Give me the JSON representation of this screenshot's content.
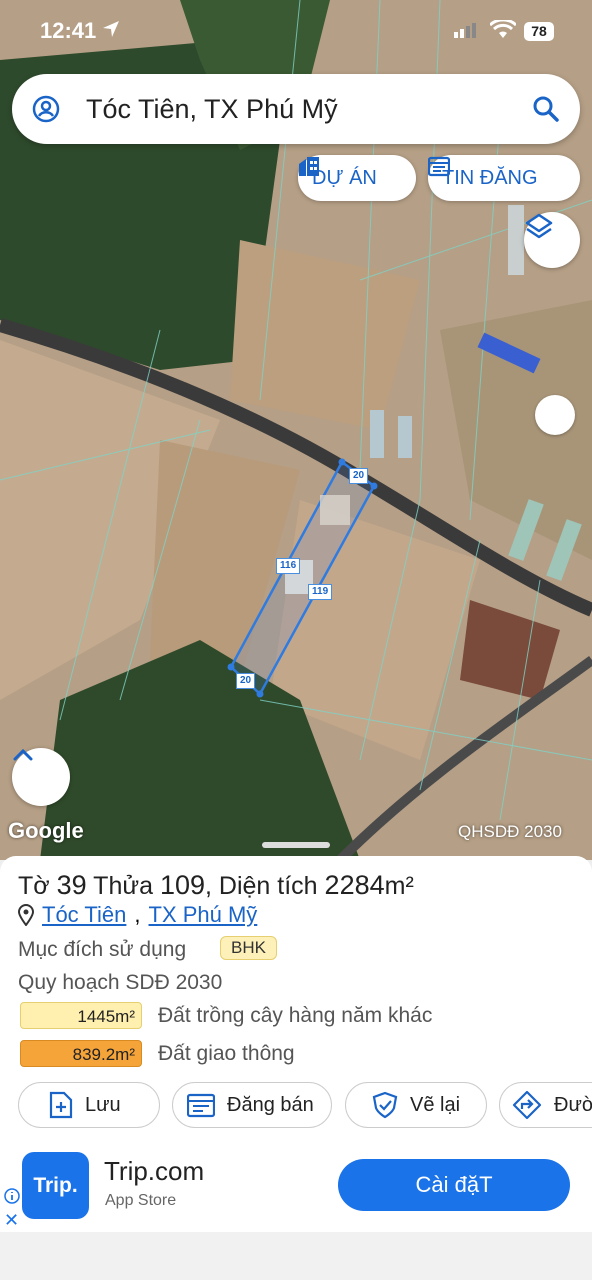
{
  "status_bar": {
    "time": "12:41",
    "battery": "78"
  },
  "search": {
    "text": "Tóc Tiên, TX Phú Mỹ"
  },
  "chips": {
    "projects": "DỰ ÁN",
    "listings": "TIN ĐĂNG"
  },
  "map": {
    "google": "Google",
    "layer": "QHSDĐ 2030",
    "edges": {
      "top": "20",
      "left": "116",
      "right": "119",
      "bottom": "20"
    }
  },
  "parcel": {
    "title_prefix": "Tờ",
    "sheet_no": "39",
    "lot_label": "Thửa",
    "lot_no": "109",
    "area_label": "Diện tích",
    "area_value": "2284",
    "area_unit": "m²",
    "commune": "Tóc Tiên",
    "town": "TX Phú Mỹ",
    "usage_label": "Mục đích sử dụng",
    "usage_code": "BHK",
    "plan_label": "Quy hoạch SDĐ 2030",
    "zones": [
      {
        "area": "1445m²",
        "desc": "Đất trồng cây hàng năm khác",
        "color": "#fff0b0"
      },
      {
        "area": "839.2m²",
        "desc": "Đất giao thông",
        "color": "#f5a43a"
      }
    ]
  },
  "actions": {
    "save": "Lưu",
    "sell": "Đăng bán",
    "redraw": "Vẽ lại",
    "route": "Đườ"
  },
  "ad": {
    "logo": "Trip.",
    "brand": "Trip.com",
    "store": "App Store",
    "install": "Cài đặT"
  }
}
